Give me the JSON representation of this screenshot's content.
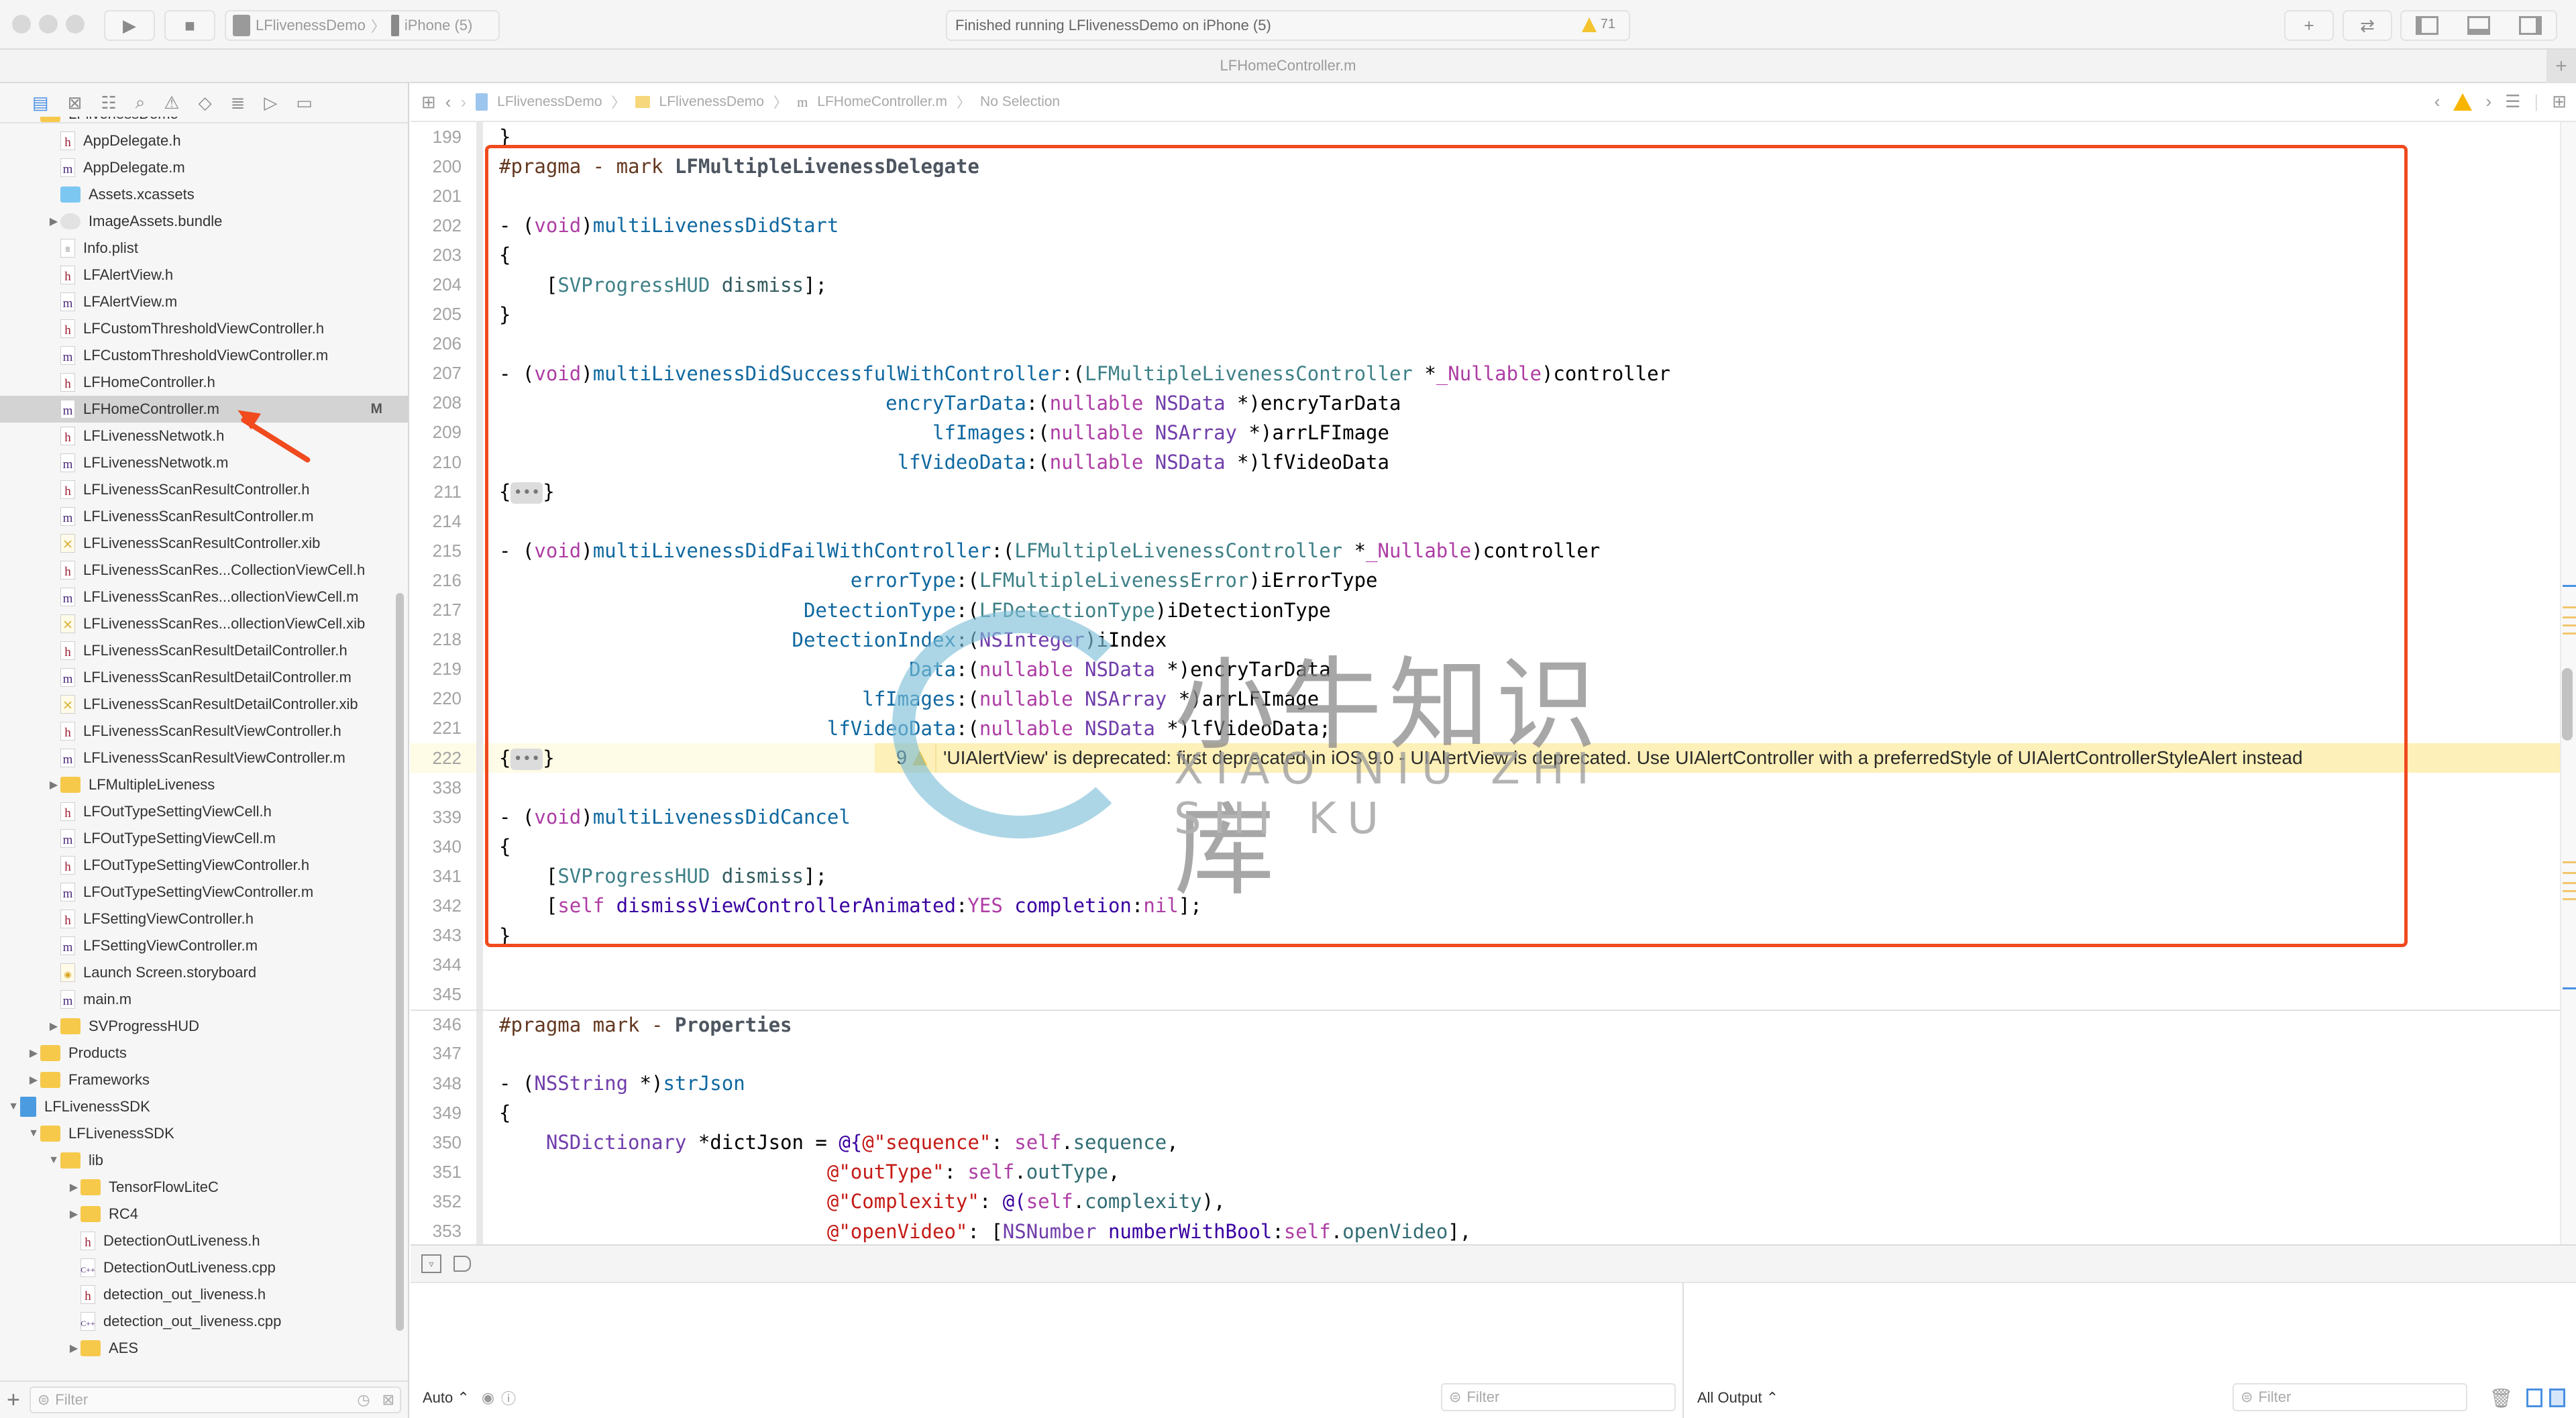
{
  "toolbar": {
    "scheme": "LFlivenessDemo",
    "device": "iPhone (5)",
    "status": "Finished running LFlivenessDemo on iPhone (5)",
    "warning_count": "71",
    "icons": [
      "run-icon",
      "stop-icon",
      "add-icon",
      "swap-icon",
      "navigator-toggle-icon",
      "debug-toggle-icon",
      "inspector-toggle-icon"
    ]
  },
  "tab": {
    "title": "LFHomeController.m"
  },
  "jumpbar": {
    "items": [
      "LFlivenessDemo",
      "LFlivenessDemo",
      "LFHomeController.m",
      "No Selection"
    ]
  },
  "navigator": {
    "tree": [
      {
        "label": "LFlivenessDemo",
        "kind": "folder",
        "depth": 1,
        "open": true
      },
      {
        "label": "AppDelegate.h",
        "kind": "h",
        "depth": 2
      },
      {
        "label": "AppDelegate.m",
        "kind": "m",
        "depth": 2
      },
      {
        "label": "Assets.xcassets",
        "kind": "assets",
        "depth": 2
      },
      {
        "label": "ImageAssets.bundle",
        "kind": "bundle",
        "depth": 2,
        "closed": true
      },
      {
        "label": "Info.plist",
        "kind": "plist",
        "depth": 2
      },
      {
        "label": "LFAlertView.h",
        "kind": "h",
        "depth": 2
      },
      {
        "label": "LFAlertView.m",
        "kind": "m",
        "depth": 2
      },
      {
        "label": "LFCustomThresholdViewController.h",
        "kind": "h",
        "depth": 2
      },
      {
        "label": "LFCustomThresholdViewController.m",
        "kind": "m",
        "depth": 2
      },
      {
        "label": "LFHomeController.h",
        "kind": "h",
        "depth": 2
      },
      {
        "label": "LFHomeController.m",
        "kind": "m",
        "depth": 2,
        "selected": true,
        "badge": "M"
      },
      {
        "label": "LFLivenessNetwotk.h",
        "kind": "h",
        "depth": 2
      },
      {
        "label": "LFLivenessNetwotk.m",
        "kind": "m",
        "depth": 2
      },
      {
        "label": "LFLivenessScanResultController.h",
        "kind": "h",
        "depth": 2
      },
      {
        "label": "LFLivenessScanResultController.m",
        "kind": "m",
        "depth": 2
      },
      {
        "label": "LFLivenessScanResultController.xib",
        "kind": "xib",
        "depth": 2
      },
      {
        "label": "LFLivenessScanRes...CollectionViewCell.h",
        "kind": "h",
        "depth": 2
      },
      {
        "label": "LFLivenessScanRes...ollectionViewCell.m",
        "kind": "m",
        "depth": 2
      },
      {
        "label": "LFLivenessScanRes...ollectionViewCell.xib",
        "kind": "xib",
        "depth": 2
      },
      {
        "label": "LFLivenessScanResultDetailController.h",
        "kind": "h",
        "depth": 2
      },
      {
        "label": "LFLivenessScanResultDetailController.m",
        "kind": "m",
        "depth": 2
      },
      {
        "label": "LFLivenessScanResultDetailController.xib",
        "kind": "xib",
        "depth": 2
      },
      {
        "label": "LFLivenessScanResultViewController.h",
        "kind": "h",
        "depth": 2
      },
      {
        "label": "LFLivenessScanResultViewController.m",
        "kind": "m",
        "depth": 2
      },
      {
        "label": "LFMultipleLiveness",
        "kind": "folder",
        "depth": 2,
        "closed": true
      },
      {
        "label": "LFOutTypeSettingViewCell.h",
        "kind": "h",
        "depth": 2
      },
      {
        "label": "LFOutTypeSettingViewCell.m",
        "kind": "m",
        "depth": 2
      },
      {
        "label": "LFOutTypeSettingViewController.h",
        "kind": "h",
        "depth": 2
      },
      {
        "label": "LFOutTypeSettingViewController.m",
        "kind": "m",
        "depth": 2
      },
      {
        "label": "LFSettingViewController.h",
        "kind": "h",
        "depth": 2
      },
      {
        "label": "LFSettingViewController.m",
        "kind": "m",
        "depth": 2
      },
      {
        "label": "Launch Screen.storyboard",
        "kind": "storyboard",
        "depth": 2
      },
      {
        "label": "main.m",
        "kind": "m",
        "depth": 2
      },
      {
        "label": "SVProgressHUD",
        "kind": "folder",
        "depth": 2,
        "closed": true
      },
      {
        "label": "Products",
        "kind": "folder",
        "depth": 1,
        "closed": true
      },
      {
        "label": "Frameworks",
        "kind": "folder",
        "depth": 1,
        "closed": true
      },
      {
        "label": "LFLivenessSDK",
        "kind": "project",
        "depth": 0,
        "open": true
      },
      {
        "label": "LFLivenessSDK",
        "kind": "folder",
        "depth": 1,
        "open": true
      },
      {
        "label": "lib",
        "kind": "folder",
        "depth": 2,
        "open": true
      },
      {
        "label": "TensorFlowLiteC",
        "kind": "folder",
        "depth": 3,
        "closed": true
      },
      {
        "label": "RC4",
        "kind": "folder",
        "depth": 3,
        "closed": true
      },
      {
        "label": "DetectionOutLiveness.h",
        "kind": "h",
        "depth": 3
      },
      {
        "label": "DetectionOutLiveness.cpp",
        "kind": "cpp",
        "depth": 3
      },
      {
        "label": "detection_out_liveness.h",
        "kind": "h",
        "depth": 3
      },
      {
        "label": "detection_out_liveness.cpp",
        "kind": "cpp",
        "depth": 3
      },
      {
        "label": "AES",
        "kind": "folder",
        "depth": 3,
        "closed": true
      }
    ],
    "filter_placeholder": "Filter"
  },
  "editor": {
    "lines": [
      {
        "n": "199",
        "t": [
          [
            "}",
            ""
          ]
        ]
      },
      {
        "n": "200",
        "t": [
          [
            "#pragma - mark ",
            "prag"
          ],
          [
            "LFMultipleLivenessDelegate",
            "prag2"
          ]
        ]
      },
      {
        "n": "201",
        "t": []
      },
      {
        "n": "202",
        "t": [
          [
            "- (",
            ""
          ],
          [
            "void",
            "kw"
          ],
          [
            ")",
            ""
          ],
          [
            "multiLivenessDidStart",
            "mth"
          ]
        ]
      },
      {
        "n": "203",
        "t": [
          [
            "{",
            ""
          ]
        ]
      },
      {
        "n": "204",
        "t": [
          [
            "    [",
            ""
          ],
          [
            "SVProgressHUD",
            "cls"
          ],
          [
            " ",
            ""
          ],
          [
            "dismiss",
            "fn"
          ],
          [
            "];",
            ""
          ]
        ]
      },
      {
        "n": "205",
        "t": [
          [
            "}",
            ""
          ]
        ]
      },
      {
        "n": "206",
        "t": []
      },
      {
        "n": "207",
        "t": [
          [
            "- (",
            ""
          ],
          [
            "void",
            "kw"
          ],
          [
            ")",
            ""
          ],
          [
            "multiLivenessDidSuccessfulWithController",
            "mth"
          ],
          [
            ":(",
            ""
          ],
          [
            "LFMultipleLivenessController",
            "cls"
          ],
          [
            " *",
            ""
          ],
          [
            "_Nullable",
            "kw"
          ],
          [
            ")controller",
            ""
          ]
        ]
      },
      {
        "n": "208",
        "t": [
          [
            "                                 ",
            ""
          ],
          [
            "encryTarData",
            "mth"
          ],
          [
            ":(",
            ""
          ],
          [
            "nullable",
            "kw"
          ],
          [
            " ",
            ""
          ],
          [
            "NSData",
            "ty"
          ],
          [
            " *)encryTarData",
            ""
          ]
        ]
      },
      {
        "n": "209",
        "t": [
          [
            "                                     ",
            ""
          ],
          [
            "lfImages",
            "mth"
          ],
          [
            ":(",
            ""
          ],
          [
            "nullable",
            "kw"
          ],
          [
            " ",
            ""
          ],
          [
            "NSArray",
            "ty"
          ],
          [
            " *)arrLFImage",
            ""
          ]
        ]
      },
      {
        "n": "210",
        "t": [
          [
            "                                  ",
            ""
          ],
          [
            "lfVideoData",
            "mth"
          ],
          [
            ":(",
            ""
          ],
          [
            "nullable",
            "kw"
          ],
          [
            " ",
            ""
          ],
          [
            "NSData",
            "ty"
          ],
          [
            " *)lfVideoData",
            ""
          ]
        ]
      },
      {
        "n": "211",
        "t": [
          [
            "{",
            ""
          ],
          [
            "•••",
            "fold"
          ],
          [
            "}",
            ""
          ]
        ]
      },
      {
        "n": "214",
        "t": []
      },
      {
        "n": "215",
        "t": [
          [
            "- (",
            ""
          ],
          [
            "void",
            "kw"
          ],
          [
            ")",
            ""
          ],
          [
            "multiLivenessDidFailWithController",
            "mth"
          ],
          [
            ":(",
            ""
          ],
          [
            "LFMultipleLivenessController",
            "cls"
          ],
          [
            " *",
            ""
          ],
          [
            "_Nullable",
            "kw"
          ],
          [
            ")controller",
            ""
          ]
        ]
      },
      {
        "n": "216",
        "t": [
          [
            "                              ",
            ""
          ],
          [
            "errorType",
            "mth"
          ],
          [
            ":(",
            ""
          ],
          [
            "LFMultipleLivenessError",
            "cls"
          ],
          [
            ")iErrorType",
            ""
          ]
        ]
      },
      {
        "n": "217",
        "t": [
          [
            "                          ",
            ""
          ],
          [
            "DetectionType",
            "mth"
          ],
          [
            ":(",
            ""
          ],
          [
            "LFDetectionType",
            "cls"
          ],
          [
            ")iDetectionType",
            ""
          ]
        ]
      },
      {
        "n": "218",
        "t": [
          [
            "                         ",
            ""
          ],
          [
            "DetectionIndex",
            "mth"
          ],
          [
            ":(",
            ""
          ],
          [
            "NSInteger",
            "ty"
          ],
          [
            ")iIndex",
            ""
          ]
        ]
      },
      {
        "n": "219",
        "t": [
          [
            "                                   ",
            ""
          ],
          [
            "Data",
            "mth"
          ],
          [
            ":(",
            ""
          ],
          [
            "nullable",
            "kw"
          ],
          [
            " ",
            ""
          ],
          [
            "NSData",
            "ty"
          ],
          [
            " *)encryTarData",
            ""
          ]
        ]
      },
      {
        "n": "220",
        "t": [
          [
            "                               ",
            ""
          ],
          [
            "lfImages",
            "mth"
          ],
          [
            ":(",
            ""
          ],
          [
            "nullable",
            "kw"
          ],
          [
            " ",
            ""
          ],
          [
            "NSArray",
            "ty"
          ],
          [
            " *)arrLFImage",
            ""
          ]
        ]
      },
      {
        "n": "221",
        "t": [
          [
            "                            ",
            ""
          ],
          [
            "lfVideoData",
            "mth"
          ],
          [
            ":(",
            ""
          ],
          [
            "nullable",
            "kw"
          ],
          [
            " ",
            ""
          ],
          [
            "NSData",
            "ty"
          ],
          [
            " *)lfVideoData;",
            ""
          ]
        ]
      },
      {
        "n": "222",
        "t": [
          [
            "{",
            ""
          ],
          [
            "•••",
            "fold"
          ],
          [
            "}",
            ""
          ]
        ],
        "warning": true
      },
      {
        "n": "338",
        "t": []
      },
      {
        "n": "339",
        "t": [
          [
            "- (",
            ""
          ],
          [
            "void",
            "kw"
          ],
          [
            ")",
            ""
          ],
          [
            "multiLivenessDidCancel",
            "mth"
          ]
        ]
      },
      {
        "n": "340",
        "t": [
          [
            "{",
            ""
          ]
        ]
      },
      {
        "n": "341",
        "t": [
          [
            "    [",
            ""
          ],
          [
            "SVProgressHUD",
            "cls"
          ],
          [
            " ",
            ""
          ],
          [
            "dismiss",
            "fn"
          ],
          [
            "];",
            ""
          ]
        ]
      },
      {
        "n": "342",
        "t": [
          [
            "    [",
            ""
          ],
          [
            "self",
            "kw"
          ],
          [
            " ",
            ""
          ],
          [
            "dismissViewControllerAnimated",
            "at"
          ],
          [
            ":",
            ""
          ],
          [
            "YES",
            "kw"
          ],
          [
            " ",
            ""
          ],
          [
            "completion",
            "at"
          ],
          [
            ":",
            ""
          ],
          [
            "nil",
            "kw"
          ],
          [
            "];",
            ""
          ]
        ]
      },
      {
        "n": "343",
        "t": [
          [
            "}",
            ""
          ]
        ]
      },
      {
        "n": "344",
        "t": []
      },
      {
        "n": "345",
        "t": []
      },
      {
        "n": "346",
        "t": [
          [
            "#pragma mark - ",
            "prag"
          ],
          [
            "Properties",
            "prag2"
          ]
        ],
        "divider": true
      },
      {
        "n": "347",
        "t": []
      },
      {
        "n": "348",
        "t": [
          [
            "- (",
            ""
          ],
          [
            "NSString",
            "ty"
          ],
          [
            " *)",
            ""
          ],
          [
            "strJson",
            "mth"
          ]
        ]
      },
      {
        "n": "349",
        "t": [
          [
            "{",
            ""
          ]
        ]
      },
      {
        "n": "350",
        "t": [
          [
            "    ",
            ""
          ],
          [
            "NSDictionary",
            "ty"
          ],
          [
            " *dictJson = ",
            ""
          ],
          [
            "@{",
            "at"
          ],
          [
            "@\"sequence\"",
            "str"
          ],
          [
            ": ",
            ""
          ],
          [
            "self",
            "kw"
          ],
          [
            ".",
            ""
          ],
          [
            "sequence",
            "pr"
          ],
          [
            ",",
            ""
          ]
        ]
      },
      {
        "n": "351",
        "t": [
          [
            "                            ",
            ""
          ],
          [
            "@\"outType\"",
            "str"
          ],
          [
            ": ",
            ""
          ],
          [
            "self",
            "kw"
          ],
          [
            ".",
            ""
          ],
          [
            "outType",
            "pr"
          ],
          [
            ",",
            ""
          ]
        ]
      },
      {
        "n": "352",
        "t": [
          [
            "                            ",
            ""
          ],
          [
            "@\"Complexity\"",
            "str"
          ],
          [
            ": ",
            ""
          ],
          [
            "@(",
            "at"
          ],
          [
            "self",
            "kw"
          ],
          [
            ".",
            ""
          ],
          [
            "complexity",
            "pr"
          ],
          [
            "),",
            ""
          ]
        ]
      },
      {
        "n": "353",
        "t": [
          [
            "                            ",
            ""
          ],
          [
            "@\"openVideo\"",
            "str"
          ],
          [
            ": [",
            ""
          ],
          [
            "NSNumber",
            "ty"
          ],
          [
            " ",
            ""
          ],
          [
            "numberWithBool",
            "at"
          ],
          [
            ":",
            ""
          ],
          [
            "self",
            "kw"
          ],
          [
            ".",
            ""
          ],
          [
            "openVideo",
            "pr"
          ],
          [
            "],",
            ""
          ]
        ]
      }
    ],
    "warning": {
      "count": "9",
      "message": "'UIAlertView' is deprecated: first deprecated in iOS 9.0 - UIAlertView is deprecated. Use UIAlertController with a preferredStyle of UIAlertControllerStyleAlert instead"
    }
  },
  "watermark": {
    "title": "小牛知识库",
    "subtitle": "XIAO NIU ZHI SHI KU"
  },
  "debug": {
    "variables_scope": "Auto ⌃",
    "console_scope": "All Output ⌃",
    "filter_placeholder": "Filter"
  },
  "colors": {
    "annotation": "#f04a1e",
    "warning_bg": "#fdf0b8",
    "selection": "#d3d3d3"
  }
}
